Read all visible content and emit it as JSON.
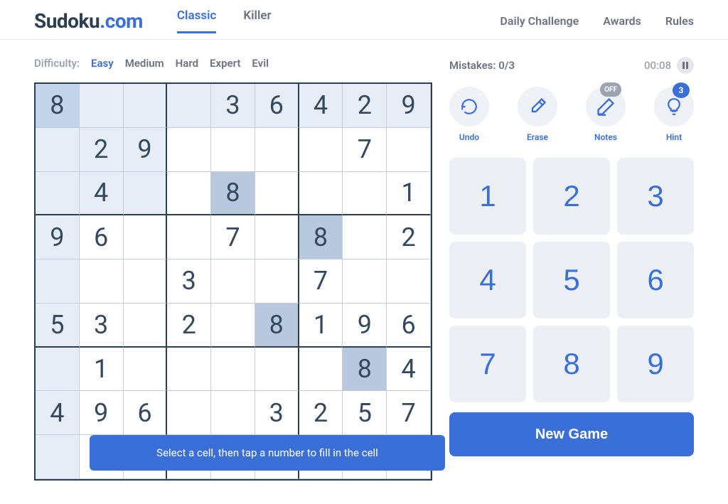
{
  "logo": {
    "text": "Sudoku",
    "suffix": ".com"
  },
  "nav_primary": [
    {
      "label": "Classic",
      "active": true
    },
    {
      "label": "Killer",
      "active": false
    }
  ],
  "nav_secondary": [
    {
      "label": "Daily Challenge"
    },
    {
      "label": "Awards"
    },
    {
      "label": "Rules"
    }
  ],
  "difficulty": {
    "label": "Difficulty:",
    "levels": [
      {
        "label": "Easy",
        "active": true
      },
      {
        "label": "Medium",
        "active": false
      },
      {
        "label": "Hard",
        "active": false
      },
      {
        "label": "Expert",
        "active": false
      },
      {
        "label": "Evil",
        "active": false
      }
    ]
  },
  "status": {
    "mistakes_label": "Mistakes:",
    "mistakes_value": "0/3",
    "timer": "00:08"
  },
  "tools": {
    "undo": "Undo",
    "erase": "Erase",
    "notes": "Notes",
    "notes_badge": "OFF",
    "hint": "Hint",
    "hint_badge": "3"
  },
  "numpad": [
    "1",
    "2",
    "3",
    "4",
    "5",
    "6",
    "7",
    "8",
    "9"
  ],
  "newgame": "New Game",
  "tooltip": "Select a cell, then tap a number to fill in the cell",
  "board": {
    "selected": [
      0,
      0
    ],
    "grid": [
      [
        "8",
        "",
        "",
        "",
        "3",
        "6",
        "4",
        "2",
        "9"
      ],
      [
        "",
        "2",
        "9",
        "",
        "",
        "",
        "",
        "7",
        ""
      ],
      [
        "",
        "4",
        "",
        "",
        "8",
        "",
        "",
        "",
        "1"
      ],
      [
        "9",
        "6",
        "",
        "",
        "7",
        "",
        "8",
        "",
        "2"
      ],
      [
        "",
        "",
        "",
        "3",
        "",
        "",
        "7",
        "",
        ""
      ],
      [
        "5",
        "3",
        "",
        "2",
        "",
        "8",
        "1",
        "9",
        "6"
      ],
      [
        "",
        "1",
        "",
        "",
        "",
        "",
        "",
        "8",
        "4"
      ],
      [
        "4",
        "9",
        "6",
        "",
        "",
        "3",
        "2",
        "5",
        "7"
      ],
      [
        "",
        "",
        "",
        "",
        "",
        "",
        "",
        "",
        ""
      ]
    ]
  }
}
